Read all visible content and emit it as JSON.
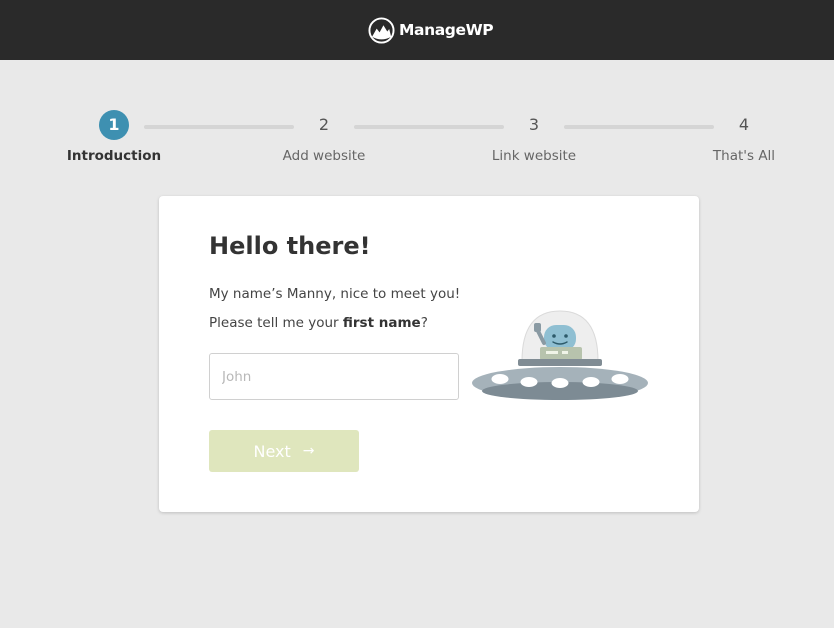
{
  "header": {
    "brand_name": "ManageWP",
    "background_color": "#2a2a2a"
  },
  "stepper": {
    "active_color": "#3e90b1",
    "steps": [
      {
        "number": "1",
        "label": "Introduction",
        "active": true
      },
      {
        "number": "2",
        "label": "Add website",
        "active": false
      },
      {
        "number": "3",
        "label": "Link website",
        "active": false
      },
      {
        "number": "4",
        "label": "That's All",
        "active": false
      }
    ]
  },
  "card": {
    "title": "Hello there!",
    "greeting": "My name’s Manny, nice to meet you!",
    "prompt_prefix": "Please tell me your ",
    "prompt_bold": "first name",
    "prompt_suffix": "?",
    "name_input": {
      "value": "",
      "placeholder": "John"
    },
    "next_button": {
      "label": "Next",
      "arrow_icon": "arrow-right-icon",
      "color": "#dfe6bd"
    },
    "illustration": "ufo-robot-illustration"
  }
}
